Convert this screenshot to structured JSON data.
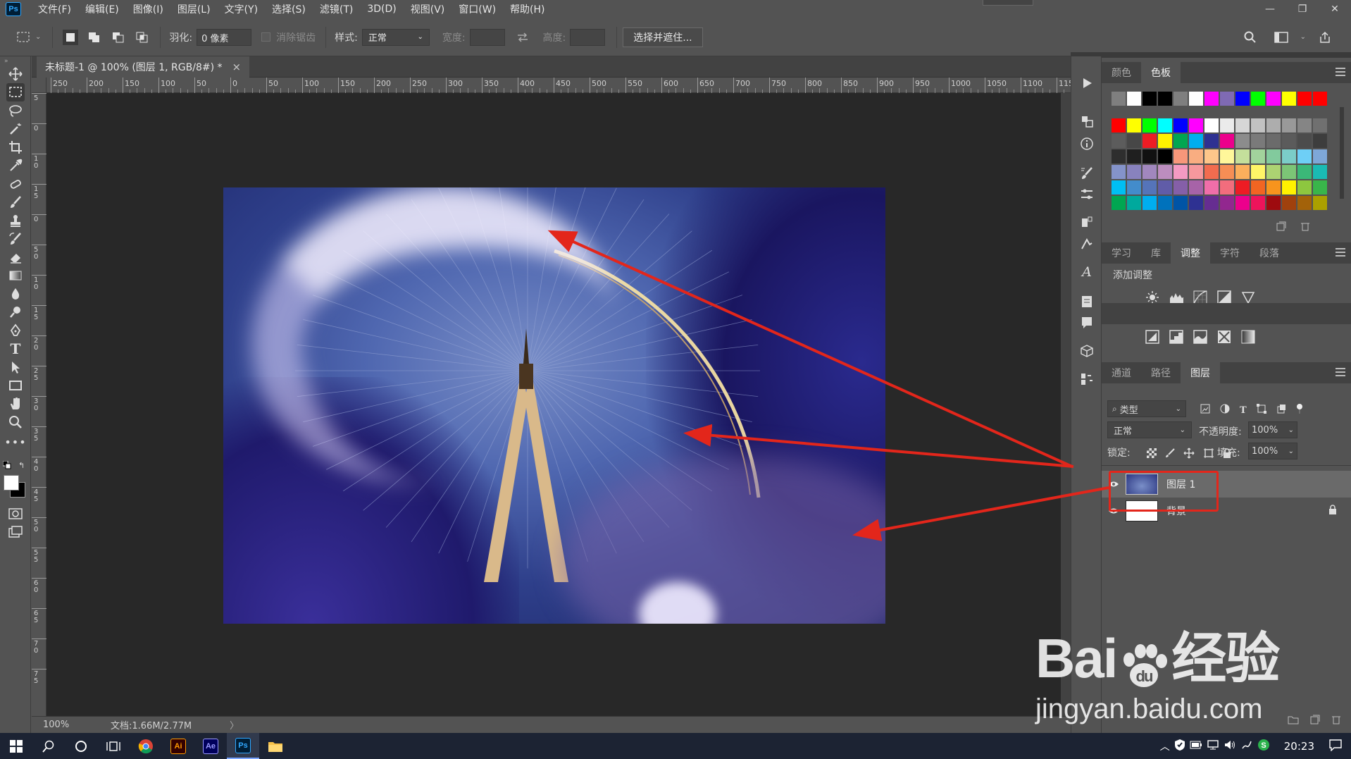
{
  "app": {
    "logo": "Ps",
    "menu": [
      "文件(F)",
      "编辑(E)",
      "图像(I)",
      "图层(L)",
      "文字(Y)",
      "选择(S)",
      "滤镜(T)",
      "3D(D)",
      "视图(V)",
      "窗口(W)",
      "帮助(H)"
    ]
  },
  "options": {
    "feather_label": "羽化:",
    "feather_value": "0 像素",
    "antialias_label": "消除锯齿",
    "style_label": "样式:",
    "style_value": "正常",
    "width_label": "宽度:",
    "height_label": "高度:",
    "select_mask_button": "选择并遮住..."
  },
  "document": {
    "tab_title": "未标题-1 @ 100% (图层 1, RGB/8#) *",
    "close": "×",
    "zoom": "100%",
    "doc_info": "文档:1.66M/2.77M",
    "status_arrow": "〉"
  },
  "ruler": {
    "h_ticks": [
      "250",
      "200",
      "150",
      "100",
      "50",
      "0",
      "50",
      "100",
      "150",
      "200",
      "250",
      "300",
      "350",
      "400",
      "450",
      "500",
      "550",
      "600",
      "650",
      "700",
      "750",
      "800",
      "850",
      "900",
      "950",
      "1000",
      "1050",
      "1100",
      "1150"
    ],
    "v_ticks": [
      "5",
      "0",
      "1 0",
      "1 5",
      "0",
      "5 0",
      "1 0",
      "1 5",
      "2 0",
      "2 5",
      "3 0",
      "3 5",
      "4 0",
      "4 5",
      "5 0",
      "5 5",
      "6 0",
      "6 5",
      "7 0",
      "7 5"
    ]
  },
  "panels": {
    "color_tabs": [
      "颜色",
      "色板"
    ],
    "recent_swatches": [
      "#7f7f7f",
      "#ffffff",
      "#000000",
      "#000000",
      "#7f7f7f",
      "#ffffff",
      "#ff00ff",
      "#7f6ab4",
      "#0000ff",
      "#00ff00",
      "#ff00ff",
      "#ffff00",
      "#ff0000",
      "#ff0000"
    ],
    "swatches": [
      "#ff0000",
      "#ffff00",
      "#00ff00",
      "#00ffff",
      "#0000ff",
      "#ff00ff",
      "#ffffff",
      "#ebebeb",
      "#d6d6d6",
      "#c2c2c2",
      "#adadad",
      "#999999",
      "#858585",
      "#707070",
      "#5c5c5c",
      "#474747",
      "#ed1c24",
      "#fff200",
      "#00a651",
      "#00aeef",
      "#2e3192",
      "#ec008c",
      "#8c8c8c",
      "#7a7a7a",
      "#6b6b6b",
      "#5b5b5b",
      "#4c4c4c",
      "#3d3d3d",
      "#2e2e2e",
      "#1f1f1f",
      "#111111",
      "#000000",
      "#f7977a",
      "#f9ad81",
      "#fdc68a",
      "#fff79a",
      "#c4df9b",
      "#a2d39c",
      "#82ca9d",
      "#7bcdc8",
      "#6ecff6",
      "#7ea7d8",
      "#8493ca",
      "#8882be",
      "#a187be",
      "#bc8dbf",
      "#f49ac2",
      "#f6989d",
      "#f26c4f",
      "#f68e55",
      "#fbaf5c",
      "#fff467",
      "#acd372",
      "#7cc576",
      "#3bb878",
      "#1abbb4",
      "#00bff3",
      "#438ccb",
      "#5574b9",
      "#605ca8",
      "#855fa8",
      "#a763a8",
      "#f06ea9",
      "#f26d7d",
      "#ed1c24",
      "#f26522",
      "#f7941d",
      "#fff200",
      "#8dc73f",
      "#39b54a",
      "#00a651",
      "#00a99d",
      "#00aeef",
      "#0072bc",
      "#0054a6",
      "#2e3192",
      "#662d91",
      "#92278f",
      "#ec008c",
      "#ed145b",
      "#9e0b0f",
      "#a0410d",
      "#a36209",
      "#aba000"
    ],
    "adjust_tabs": [
      "学习",
      "库",
      "调整",
      "字符",
      "段落"
    ],
    "adjust_title": "添加调整",
    "layers_tabs": [
      "通道",
      "路径",
      "图层"
    ],
    "layer_filter": "类型",
    "blend_mode": "正常",
    "opacity_label": "不透明度:",
    "opacity_value": "100%",
    "lock_label": "锁定:",
    "fill_label": "填充:",
    "fill_value": "100%",
    "layers": [
      {
        "name": "图层 1"
      },
      {
        "name": "背景"
      }
    ]
  },
  "taskbar": {
    "time": "20:23",
    "apps": [
      "Ai",
      "Ae",
      "Ps"
    ]
  },
  "watermark": {
    "brand": "Bai",
    "brand2": "经验",
    "url": "jingyan.baidu.com"
  }
}
